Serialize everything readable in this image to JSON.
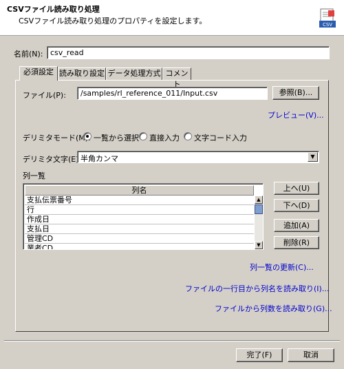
{
  "header": {
    "title": "CSVファイル読み取り処理",
    "subtitle": "CSVファイル読み取り処理のプロパティを設定します。",
    "logo_icon": "csv-file-icon",
    "logo_text": "CSV"
  },
  "name_field": {
    "label": "名前(N):",
    "value": "csv_read"
  },
  "tabs": [
    {
      "label": "必須設定",
      "active": true
    },
    {
      "label": "読み取り設定",
      "active": false
    },
    {
      "label": "データ処理方式",
      "active": false
    },
    {
      "label": "コメント",
      "active": false
    }
  ],
  "file": {
    "label": "ファイル(P):",
    "value": "/samples/rl_reference_011/Input.csv",
    "browse_label": "参照(B)..."
  },
  "preview_link": "プレビュー(V)...",
  "delimiter_mode": {
    "label": "デリミタモード(M):",
    "options": [
      {
        "label": "一覧から選択",
        "selected": true
      },
      {
        "label": "直接入力",
        "selected": false
      },
      {
        "label": "文字コード入力",
        "selected": false
      }
    ]
  },
  "delimiter_char": {
    "label": "デリミタ文字(E):",
    "value": "半角カンマ"
  },
  "column_list": {
    "label": "列一覧",
    "header": "列名",
    "rows": [
      "支払伝票番号",
      "行",
      "作成日",
      "支払日",
      "管理CD",
      "業者CD"
    ]
  },
  "side_buttons": {
    "up": "上へ(U)",
    "down": "下へ(D)",
    "add": "追加(A)",
    "delete": "削除(R)"
  },
  "links": {
    "refresh": "列一覧の更新(C)...",
    "read_first_row": "ファイルの一行目から列名を読み取り(I)...",
    "read_count": "ファイルから列数を読み取り(G)..."
  },
  "footer": {
    "ok": "完了(F)",
    "cancel": "取消"
  }
}
